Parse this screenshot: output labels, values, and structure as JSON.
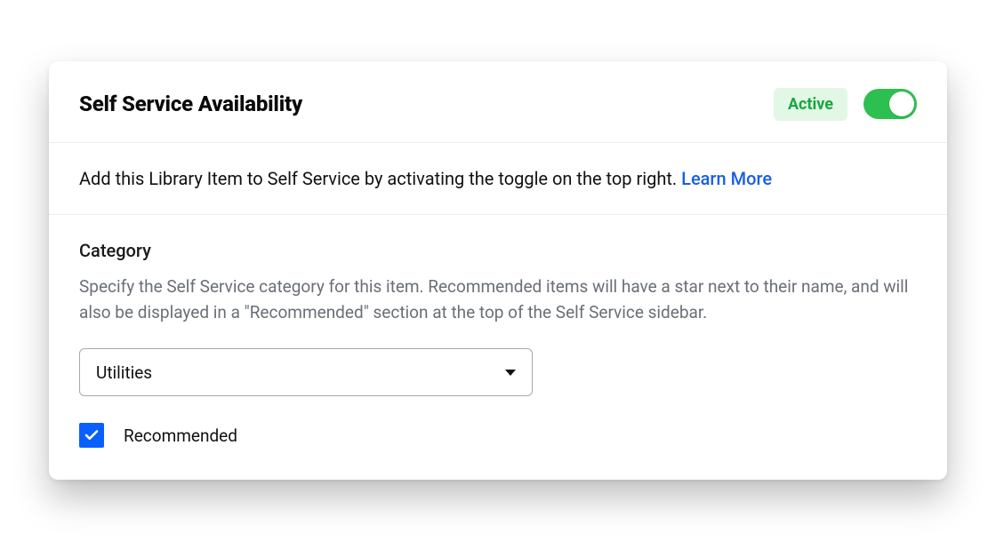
{
  "header": {
    "title": "Self Service Availability",
    "status_label": "Active",
    "toggle_on": true
  },
  "description": {
    "text": "Add this Library Item to Self Service by activating the toggle on the top right. ",
    "link_label": "Learn More"
  },
  "category_section": {
    "title": "Category",
    "description": "Specify the Self Service category for this item. Recommended items will have a star next to their name, and will also be displayed in a \"Recommended\" section at the top of the Self Service sidebar.",
    "selected_value": "Utilities",
    "recommended_checked": true,
    "recommended_label": "Recommended"
  },
  "colors": {
    "badge_bg": "#e2f7e6",
    "badge_text": "#18a73f",
    "toggle_on": "#2dc050",
    "link": "#1a5fe2",
    "checkbox": "#0b5fff"
  }
}
